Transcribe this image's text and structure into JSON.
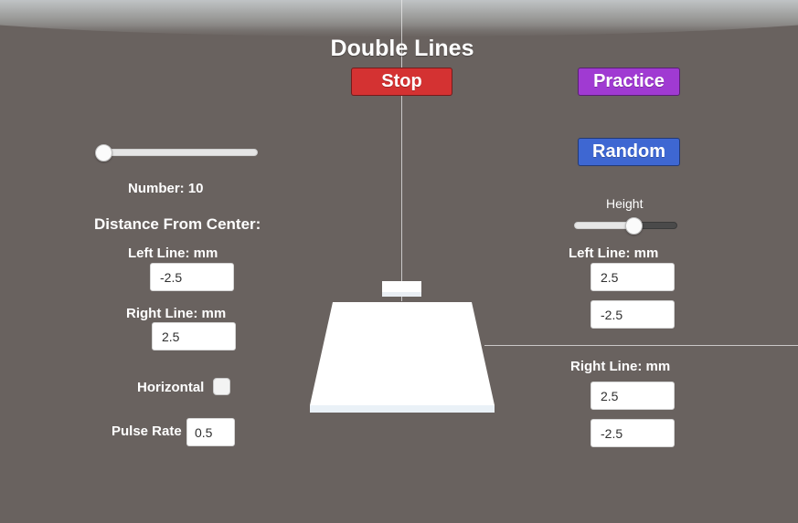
{
  "title": "Double Lines",
  "buttons": {
    "stop": "Stop",
    "practice": "Practice",
    "random": "Random"
  },
  "left_panel": {
    "number_label": "Number: 10",
    "number_slider_level": 0,
    "distance_heading": "Distance From Center:",
    "left_line_label": "Left Line: mm",
    "left_line_value": "-2.5",
    "right_line_label": "Right Line: mm",
    "right_line_value": "2.5",
    "horizontal_label": "Horizontal",
    "horizontal_checked": false,
    "pulse_rate_label": "Pulse Rate",
    "pulse_rate_value": "0.5"
  },
  "right_panel": {
    "height_label": "Height",
    "height_slider_level": 0.58,
    "left_line_label": "Left Line: mm",
    "left_line_value_1": "2.5",
    "left_line_value_2": "-2.5",
    "right_line_label": "Right Line: mm",
    "right_line_value_1": "2.5",
    "right_line_value_2": "-2.5"
  },
  "colors": {
    "background": "#69625f",
    "stop_button": "#d43232",
    "practice_button": "#a03ad2",
    "random_button": "#3e67d2"
  }
}
